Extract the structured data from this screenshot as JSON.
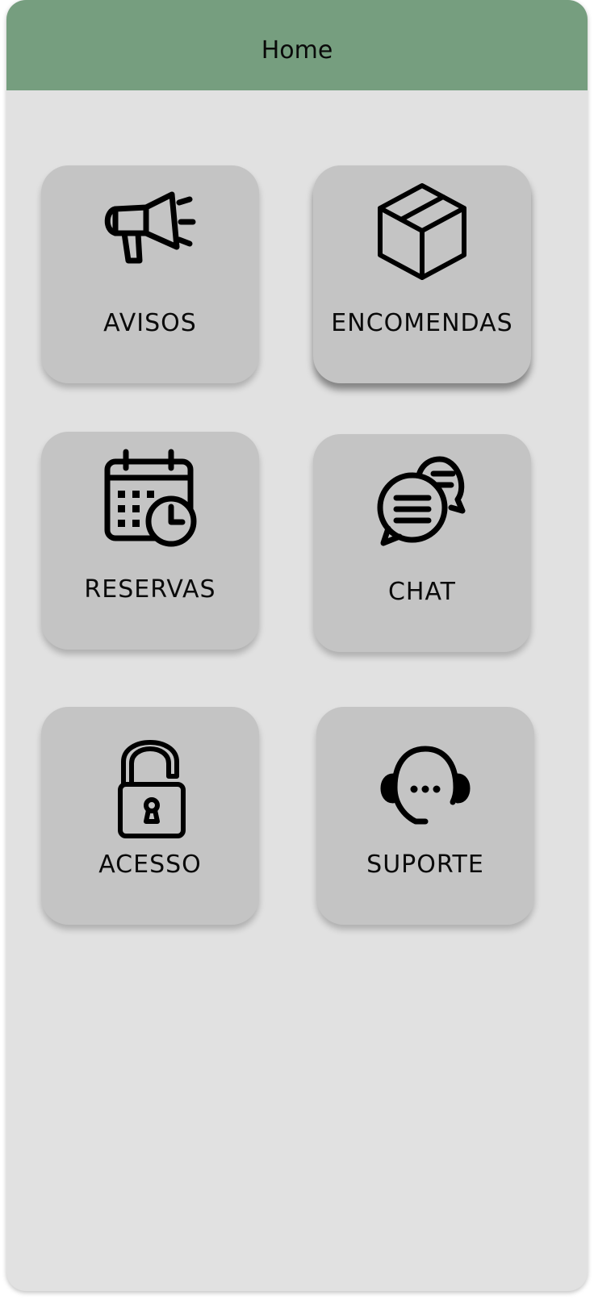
{
  "header": {
    "title": "Home"
  },
  "colors": {
    "header_bg": "#769e7f",
    "background": "#e1e1e1",
    "tile_bg": "#c4c4c4"
  },
  "tiles": [
    {
      "label": "AVISOS",
      "icon": "megaphone-icon"
    },
    {
      "label": "ENCOMENDAS",
      "icon": "package-box-icon"
    },
    {
      "label": "RESERVAS",
      "icon": "calendar-clock-icon"
    },
    {
      "label": "CHAT",
      "icon": "chat-bubbles-icon"
    },
    {
      "label": "ACESSO",
      "icon": "unlocked-padlock-icon"
    },
    {
      "label": "SUPORTE",
      "icon": "headset-support-icon"
    }
  ]
}
